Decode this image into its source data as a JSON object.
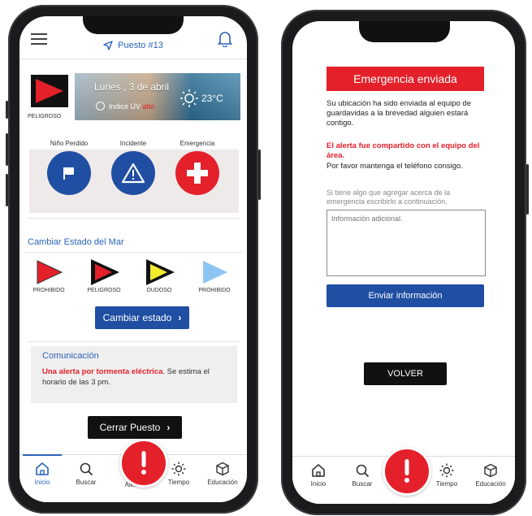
{
  "colors": {
    "brand_blue": "#1f4ea3",
    "alert_red": "#e4202a",
    "accent_blue": "#2b63b8",
    "light_gray": "#efeaea"
  },
  "left": {
    "header": {
      "station": "Puesto #13",
      "menu_icon": "menu-icon",
      "nav_icon": "navigation-icon",
      "bell_icon": "bell-icon"
    },
    "flag_status": {
      "label": "PELIGROSO"
    },
    "weather": {
      "date": "Lunes , 3 de abril",
      "uv_label": "Indice UV",
      "uv_level": "alto",
      "temperature": "23°C"
    },
    "report_buttons": [
      {
        "label": "Niño Perdido",
        "icon": "flag-icon"
      },
      {
        "label": "Incidente",
        "icon": "warning-icon"
      },
      {
        "label": "Emergencia",
        "icon": "cross-icon"
      }
    ],
    "sea_section": {
      "title": "Cambiar Estado del Mar",
      "flags": [
        {
          "label": "PROHIBIDO",
          "color": "#e4202a"
        },
        {
          "label": "PELIGROSO",
          "color": "#e4202a"
        },
        {
          "label": "DUDOSO",
          "color": "#f2ec2c"
        },
        {
          "label": "PROHIBIDO",
          "color": "#8ec4f2"
        }
      ],
      "change_button": "Cambiar estado"
    },
    "communication": {
      "title": "Comunicación",
      "alert_text": "Una alerta por tormenta eléctrica",
      "rest_text": ". Se estima el horario de las 3 pm."
    },
    "close_button": "Cerrar Puesto"
  },
  "right": {
    "banner": "Emergencia enviada",
    "message": "Su ubicación ha sido enviada al equipo de guardavidas  a la brevedad alguien estará contigo.",
    "alert_shared": "El alerta fue compartido con el equipo del área.",
    "keep_phone": "Por favor mantenga el teléfono consigo.",
    "add_info_hint": "Si tiene algo que agregar acerca de la emergencia escribirlo a continuación.",
    "textarea_placeholder": "Información adicional.",
    "send_button": "Enviar información",
    "back_button": "VOLVER"
  },
  "tabbar": {
    "items": [
      {
        "label": "Inicio",
        "icon": "home-icon"
      },
      {
        "label": "Buscar",
        "icon": "search-icon"
      },
      {
        "label": "Alerta",
        "icon": "alert-icon"
      },
      {
        "label": "Tiempo",
        "icon": "sun-icon"
      },
      {
        "label": "Educación",
        "icon": "cube-icon"
      }
    ]
  }
}
